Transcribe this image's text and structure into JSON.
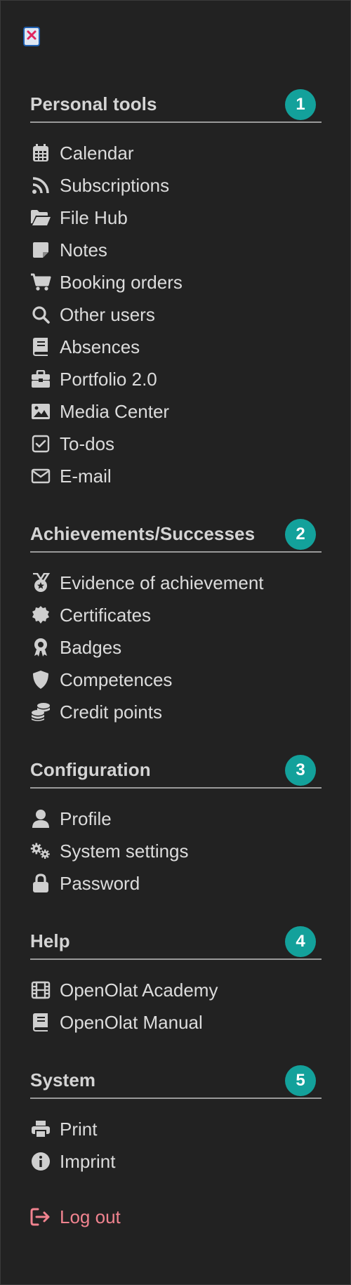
{
  "close_button": {
    "icon": "close-icon"
  },
  "sections": [
    {
      "title": "Personal tools",
      "step": "1",
      "items": [
        {
          "label": "Calendar",
          "icon": "calendar-icon"
        },
        {
          "label": "Subscriptions",
          "icon": "rss-icon"
        },
        {
          "label": "File Hub",
          "icon": "folder-open-icon"
        },
        {
          "label": "Notes",
          "icon": "note-icon"
        },
        {
          "label": "Booking orders",
          "icon": "cart-icon"
        },
        {
          "label": "Other users",
          "icon": "search-icon"
        },
        {
          "label": "Absences",
          "icon": "book-icon"
        },
        {
          "label": "Portfolio 2.0",
          "icon": "briefcase-icon"
        },
        {
          "label": "Media Center",
          "icon": "image-icon"
        },
        {
          "label": "To-dos",
          "icon": "checkbox-icon"
        },
        {
          "label": "E-mail",
          "icon": "envelope-icon"
        }
      ]
    },
    {
      "title": "Achievements/Successes",
      "step": "2",
      "items": [
        {
          "label": "Evidence of achievement",
          "icon": "medal-icon"
        },
        {
          "label": "Certificates",
          "icon": "certificate-icon"
        },
        {
          "label": "Badges",
          "icon": "award-icon"
        },
        {
          "label": "Competences",
          "icon": "shield-icon"
        },
        {
          "label": "Credit points",
          "icon": "coins-icon"
        }
      ]
    },
    {
      "title": "Configuration",
      "step": "3",
      "items": [
        {
          "label": "Profile",
          "icon": "user-icon"
        },
        {
          "label": "System settings",
          "icon": "gears-icon"
        },
        {
          "label": "Password",
          "icon": "lock-icon"
        }
      ]
    },
    {
      "title": "Help",
      "step": "4",
      "items": [
        {
          "label": "OpenOlat Academy",
          "icon": "film-icon"
        },
        {
          "label": "OpenOlat Manual",
          "icon": "book-icon"
        }
      ]
    },
    {
      "title": "System",
      "step": "5",
      "items": [
        {
          "label": "Print",
          "icon": "print-icon"
        },
        {
          "label": "Imprint",
          "icon": "info-icon"
        }
      ]
    }
  ],
  "logout": {
    "label": "Log out",
    "icon": "sign-out-icon"
  },
  "colors": {
    "background": "#222222",
    "step_badge": "#13a19b",
    "logout": "#f0838f",
    "text": "#dcdcdc"
  }
}
